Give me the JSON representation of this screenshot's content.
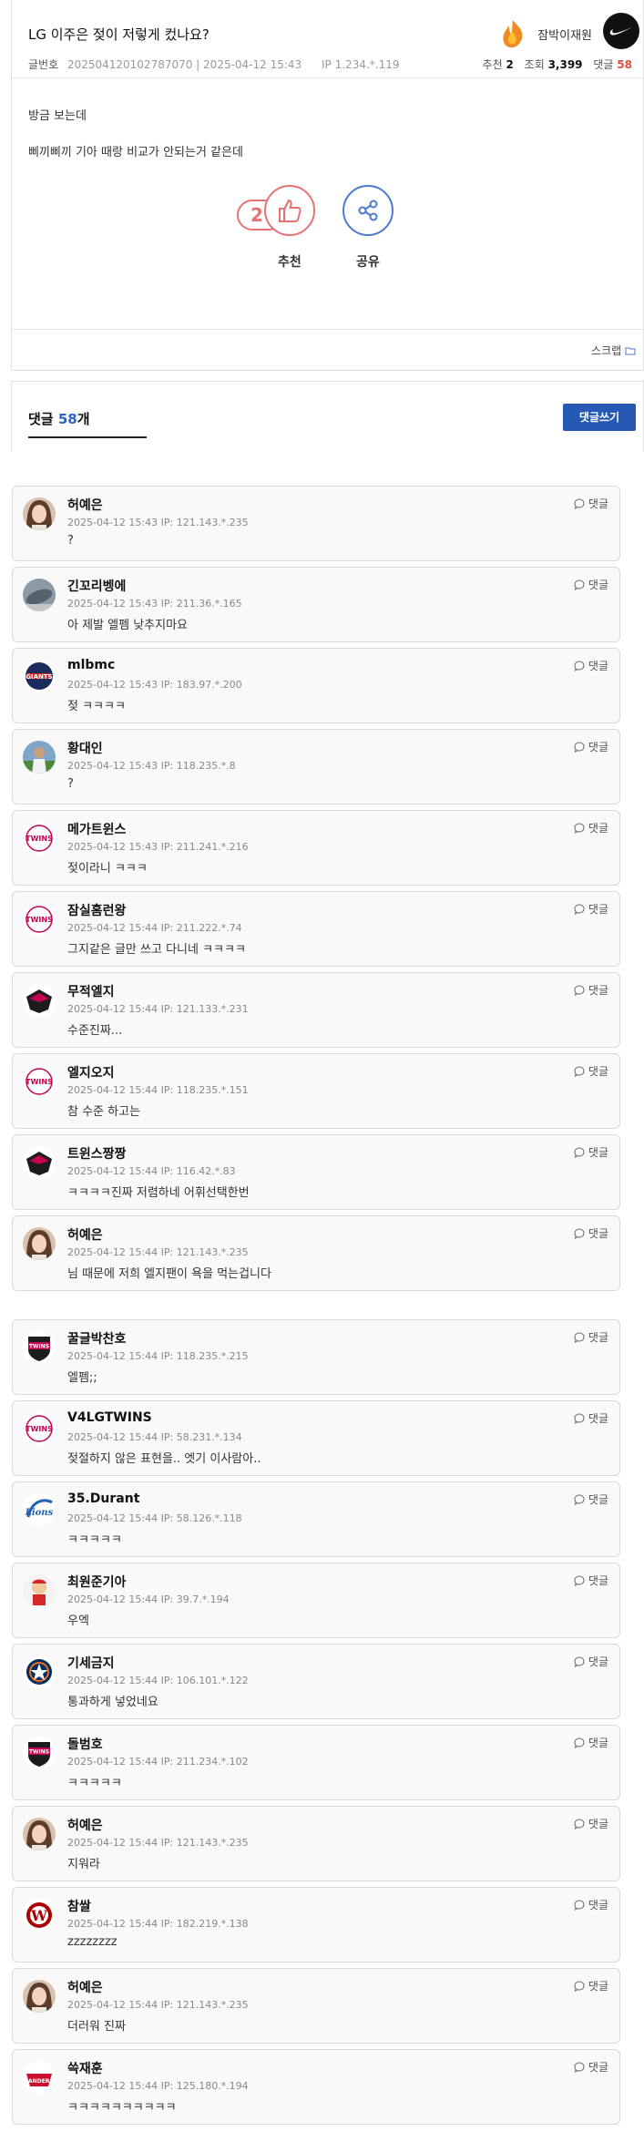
{
  "post": {
    "title": "LG 이주은 젖이 저렇게 컸나요?",
    "meta_label": "글번호",
    "meta_info": "202504120102787070 | 2025-04-12 15:43",
    "ip": "IP 1.234.*.119",
    "author": "잠박이재원",
    "stats": {
      "recommend_label": "추천",
      "recommend": "2",
      "views_label": "조회",
      "views": "3,399",
      "comments_label": "댓글",
      "comments": "58"
    },
    "body": [
      "방금 보는데",
      "삐끼삐끼 기아 때랑 비교가 안되는거 같은데"
    ],
    "vote": {
      "count": "2",
      "recommend_label": "추천",
      "share_label": "공유"
    },
    "scrap_label": "스크랩"
  },
  "comments_header": {
    "label": "댓글",
    "count": "58",
    "suffix": "개",
    "write_button": "댓글쓰기"
  },
  "reply_label": "댓글",
  "comments": [
    {
      "nick": "허예은",
      "meta": "2025-04-12 15:43  IP: 121.143.*.235",
      "text": "?",
      "avatar": "woman-photo"
    },
    {
      "nick": "긴꼬리벵에",
      "meta": "2025-04-12 15:43  IP: 211.36.*.165",
      "text": "아 제발 엘펨 낮추지마요",
      "avatar": "fish-photo"
    },
    {
      "nick": "mlbmc",
      "meta": "2025-04-12 15:43  IP: 183.97.*.200",
      "text": "젖 ㅋㅋㅋㅋ",
      "avatar": "giants-logo"
    },
    {
      "nick": "황대인",
      "meta": "2025-04-12 15:43  IP: 118.235.*.8",
      "text": "?",
      "avatar": "player-photo"
    },
    {
      "nick": "메가트윈스",
      "meta": "2025-04-12 15:43  IP: 211.241.*.216",
      "text": "젖이라니 ㅋㅋㅋ",
      "avatar": "twins-logo"
    },
    {
      "nick": "잠실홈런왕",
      "meta": "2025-04-12 15:44  IP: 211.222.*.74",
      "text": "그지같은 글만 쓰고 다니네 ㅋㅋㅋㅋ",
      "avatar": "twins-logo"
    },
    {
      "nick": "무적엘지",
      "meta": "2025-04-12 15:44  IP: 121.133.*.231",
      "text": "수준진짜...",
      "avatar": "twins-emblem"
    },
    {
      "nick": "엘지오지",
      "meta": "2025-04-12 15:44  IP: 118.235.*.151",
      "text": "참 수준 하고는",
      "avatar": "twins-logo"
    },
    {
      "nick": "트윈스짱짱",
      "meta": "2025-04-12 15:44  IP: 116.42.*.83",
      "text": "ㅋㅋㅋㅋ진짜 저렴하네 어휘선택한번",
      "avatar": "twins-emblem"
    },
    {
      "nick": "허예은",
      "meta": "2025-04-12 15:44  IP: 121.143.*.235",
      "text": "님 때문에 저희 엘지팬이 욕을 먹는겁니다",
      "avatar": "woman-photo"
    },
    {
      "nick": "꿀글박찬호",
      "meta": "2025-04-12 15:44  IP: 118.235.*.215",
      "text": "엘펨;;",
      "avatar": "twins-shield"
    },
    {
      "nick": "V4LGTWINS",
      "meta": "2025-04-12 15:44  IP: 58.231.*.134",
      "text": "젖절하지 않은 표현을.. 엣기 이사람아..",
      "avatar": "twins-logo"
    },
    {
      "nick": "35.Durant",
      "meta": "2025-04-12 15:44  IP: 58.126.*.118",
      "text": "ㅋㅋㅋㅋㅋ",
      "avatar": "lions-logo"
    },
    {
      "nick": "최원준기아",
      "meta": "2025-04-12 15:44  IP: 39.7.*.194",
      "text": "우엑",
      "avatar": "cartoon-avatar"
    },
    {
      "nick": "기세금지",
      "meta": "2025-04-12 15:44  IP: 106.101.*.122",
      "text": "통과하게 넣었네요",
      "avatar": "astros-logo"
    },
    {
      "nick": "돌범호",
      "meta": "2025-04-12 15:44  IP: 211.234.*.102",
      "text": "ㅋㅋㅋㅋㅋ",
      "avatar": "twins-shield"
    },
    {
      "nick": "허예은",
      "meta": "2025-04-12 15:44  IP: 121.143.*.235",
      "text": "지워라",
      "avatar": "woman-photo"
    },
    {
      "nick": "참쌀",
      "meta": "2025-04-12 15:44  IP: 182.219.*.138",
      "text": "zzzzzzzz",
      "avatar": "nationals-logo"
    },
    {
      "nick": "허예은",
      "meta": "2025-04-12 15:44  IP: 121.143.*.235",
      "text": "더러워 진짜",
      "avatar": "woman-photo"
    },
    {
      "nick": "쓱재훈",
      "meta": "2025-04-12 15:44  IP: 125.180.*.194",
      "text": "ㅋㅋㅋㅋㅋㅋㅋㅋㅋㅋ",
      "avatar": "landers-logo"
    }
  ]
}
